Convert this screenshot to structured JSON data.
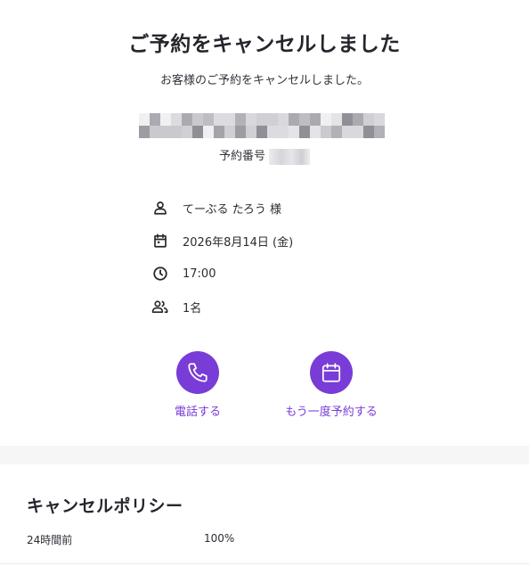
{
  "page": {
    "title": "ご予約をキャンセルしました",
    "subtitle": "お客様のご予約をキャンセルしました。"
  },
  "reservation": {
    "number_label": "予約番号"
  },
  "details": {
    "name": "てーぶる たろう 様",
    "date": "2026年8月14日 (金)",
    "time": "17:00",
    "party": "1名"
  },
  "actions": {
    "call_label": "電話する",
    "rebook_label": "もう一度予約する"
  },
  "colors": {
    "accent": "#7a3cd6",
    "divider": "#f6f6f7"
  },
  "policy": {
    "title": "キャンセルポリシー",
    "rows": [
      {
        "when": "24時間前",
        "fee": "100%"
      }
    ]
  },
  "icons": {
    "name": "person-icon",
    "date": "calendar-icon",
    "time": "clock-icon",
    "party": "people-icon",
    "call": "phone-icon",
    "rebook": "calendar-icon"
  }
}
